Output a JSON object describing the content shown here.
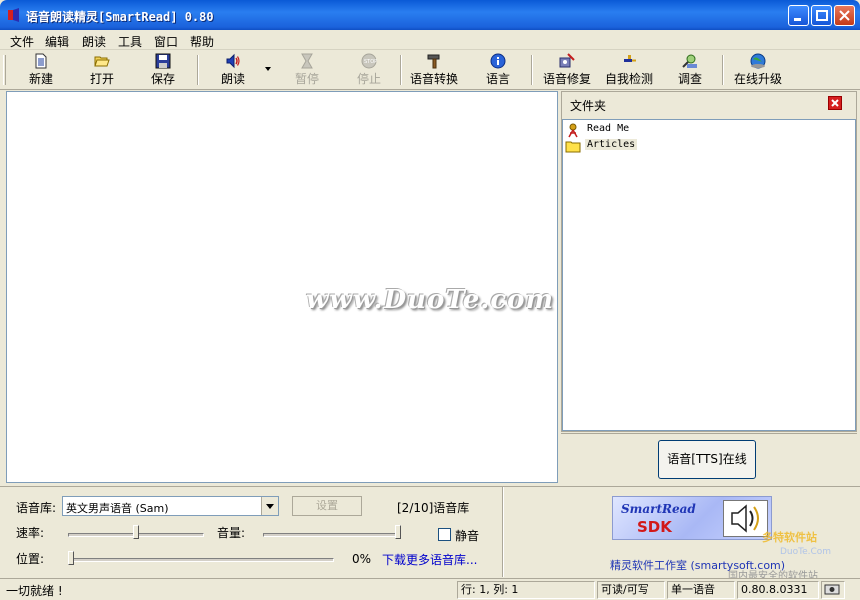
{
  "window": {
    "title": "语音朗读精灵[SmartRead] 0.80"
  },
  "menu": [
    "文件",
    "编辑",
    "朗读",
    "工具",
    "窗口",
    "帮助"
  ],
  "toolbar": {
    "new": "新建",
    "open": "打开",
    "save": "保存",
    "read": "朗读",
    "pause": "暂停",
    "stop": "停止",
    "convert": "语音转换",
    "language": "语言",
    "repair": "语音修复",
    "selfcheck": "自我检测",
    "survey": "调查",
    "upgrade": "在线升级"
  },
  "editor": {
    "watermark": "www.DuoTe.com"
  },
  "folder_panel": {
    "title": "文件夹",
    "items": [
      "Read Me",
      "Articles"
    ],
    "tts_button": "语音[TTS]在线"
  },
  "controls": {
    "voice_label": "语音库:",
    "voice_value": "英文男声语音 (Sam)",
    "settings_button": "设置",
    "voice_count": "[2/10]语音库",
    "speed_label": "速率:",
    "volume_label": "音量:",
    "mute_label": "静音",
    "position_label": "位置:",
    "position_percent": "0%",
    "download_link": "下载更多语音库...",
    "speed_level": 0.5,
    "volume_level": 1.0,
    "position_level": 0.0
  },
  "brand": {
    "logo_line1": "SmartRead",
    "logo_line2": "SDK",
    "company": "精灵软件工作室 (smartysoft.com)",
    "site_mark": "多特软件站",
    "site_url": "DuoTe.Com",
    "site_slogan": "国内最安全的软件站"
  },
  "status": {
    "ready": "一切就绪 !",
    "position": "行: 1, 列: 1",
    "access": "可读/可写",
    "voice_mode": "单一语音",
    "version": "0.80.8.0331"
  }
}
